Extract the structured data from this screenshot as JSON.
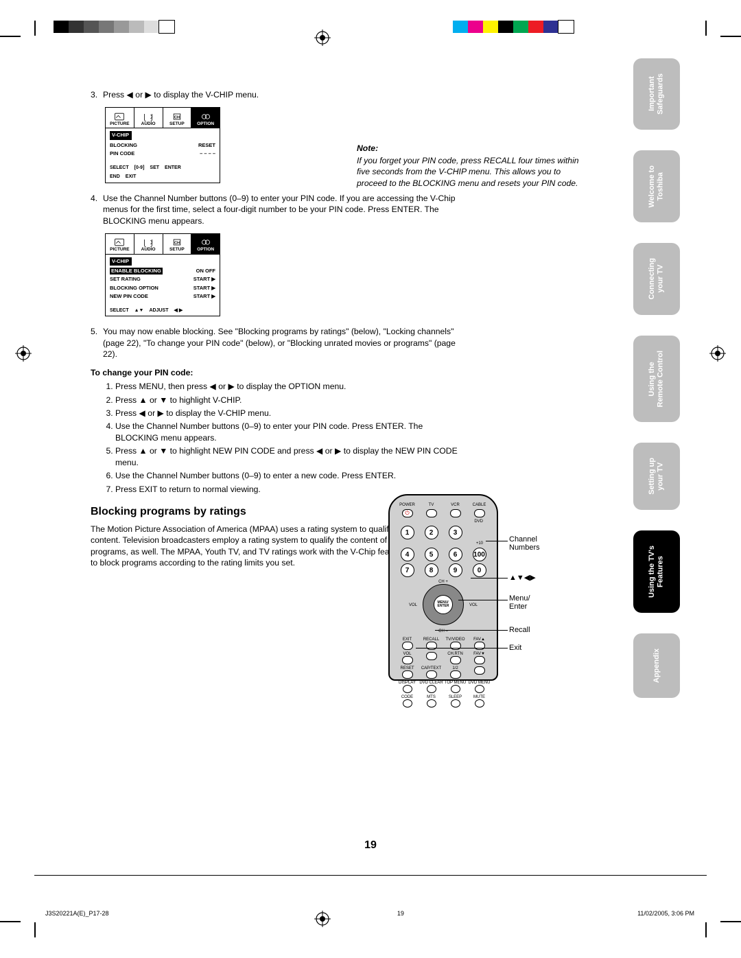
{
  "step3": "Press ◀ or ▶ to display the V-CHIP menu.",
  "step4": "Use the Channel Number buttons (0–9) to enter your PIN code. If you are accessing the V-Chip menus for the first time, select a four-digit number to be your PIN code. Press ENTER. The BLOCKING menu appears.",
  "step5": "You may now enable blocking. See \"Blocking programs by ratings\" (below), \"Locking channels\" (page 22), \"To change your PIN code\" (below), or \"Blocking unrated movies or programs\" (page 22).",
  "pinchange_hd": "To change your PIN code:",
  "pin_steps": [
    "Press MENU, then press ◀ or ▶ to display the OPTION menu.",
    "Press ▲ or ▼ to highlight V-CHIP.",
    "Press ◀ or ▶ to display the V-CHIP menu.",
    "Use the Channel Number buttons (0–9) to enter your PIN code. Press ENTER. The BLOCKING menu appears.",
    "Press ▲ or ▼ to highlight NEW PIN CODE and press ◀ or ▶ to display the NEW PIN CODE menu.",
    "Use the Channel Number buttons (0–9) to enter a new code. Press ENTER.",
    "Press EXIT to return to normal viewing."
  ],
  "section_hd": "Blocking programs by ratings",
  "section_para": "The Motion Picture Association of America (MPAA) uses a rating system to qualify motion picture content. Television broadcasters employ a rating system to qualify the content of television programs, as well. The MPAA, Youth TV, and TV ratings work with the V-Chip feature and allow you to block programs according to the rating limits you set.",
  "note_hd": "Note:",
  "note_txt": "If you forget your PIN code, press RECALL four times within five seconds from the V-CHIP menu. This allows you to proceed to the BLOCKING menu and resets your PIN code.",
  "menu1": {
    "tabs": [
      "PICTURE",
      "AUDIO",
      "SETUP",
      "OPTION"
    ],
    "head": "V-CHIP",
    "rows": [
      {
        "l": "BLOCKING",
        "r": "RESET"
      },
      {
        "l": "PIN CODE",
        "r": "– – – –"
      }
    ],
    "foot": [
      "SELECT",
      "[0-9]",
      "SET",
      "ENTER"
    ],
    "foot2": [
      "END",
      "EXIT"
    ]
  },
  "menu2": {
    "tabs": [
      "PICTURE",
      "AUDIO",
      "SETUP",
      "OPTION"
    ],
    "head": "V-CHIP",
    "rows": [
      {
        "l": "ENABLE BLOCKING",
        "r": "ON OFF",
        "sel": true
      },
      {
        "l": "SET RATING",
        "r": "START ▶"
      },
      {
        "l": "BLOCKING OPTION",
        "r": "START ▶"
      },
      {
        "l": "NEW PIN CODE",
        "r": "START ▶"
      }
    ],
    "foot": [
      "SELECT",
      "▲▼",
      "ADJUST",
      "◀ ▶"
    ]
  },
  "remote": {
    "toplabels": [
      "POWER",
      "TV",
      "VCR",
      "CABLE"
    ],
    "dvd": "DVD",
    "plus10": "+10",
    "nums": [
      "1",
      "2",
      "3",
      "4",
      "5",
      "6",
      "7",
      "8",
      "9",
      "0",
      "100"
    ],
    "ch_up": "CH +",
    "ch_dn": "CH –",
    "vol_l": "VOL",
    "vol_r": "VOL",
    "menu_enter": "MENU/\nENTER",
    "row_a": [
      "EXIT",
      "RECALL",
      "TV/VIDEO",
      "FAV▲"
    ],
    "row_b": [
      "VOL",
      "",
      "CH.RTN",
      "FAV▼"
    ],
    "row_c": [
      "RESET",
      "CAP/TEXT",
      "1/2",
      ""
    ],
    "row_d": [
      "DISPLAY",
      "DVD CLEAR",
      "TOP MENU",
      "DVD MENU"
    ],
    "row_e": [
      "CODE",
      "MTS",
      "SLEEP",
      "MUTE"
    ]
  },
  "callouts": {
    "ch": "Channel\nNumbers",
    "arrows": "▲▼◀▶",
    "menu": "Menu/\nEnter",
    "recall": "Recall",
    "exit": "Exit"
  },
  "tabs": [
    "Important\nSafeguards",
    "Welcome to\nToshiba",
    "Connecting\nyour TV",
    "Using the\nRemote Control",
    "Setting up\nyour TV",
    "Using the TV's\nFeatures",
    "Appendix"
  ],
  "active_tab": 5,
  "page_number": "19",
  "footer_left": "J3S20221A(E)_P17-28",
  "footer_mid": "19",
  "footer_right": "11/02/2005, 3:06 PM",
  "colors": {
    "bar1": [
      "#000",
      "#333",
      "#555",
      "#777",
      "#999",
      "#bbb",
      "#ddd",
      "#fff"
    ],
    "bar2": [
      "#00aeef",
      "#ec008c",
      "#fff200",
      "#000",
      "#00a651",
      "#ed1c24",
      "#2e3192",
      "#fff"
    ]
  }
}
